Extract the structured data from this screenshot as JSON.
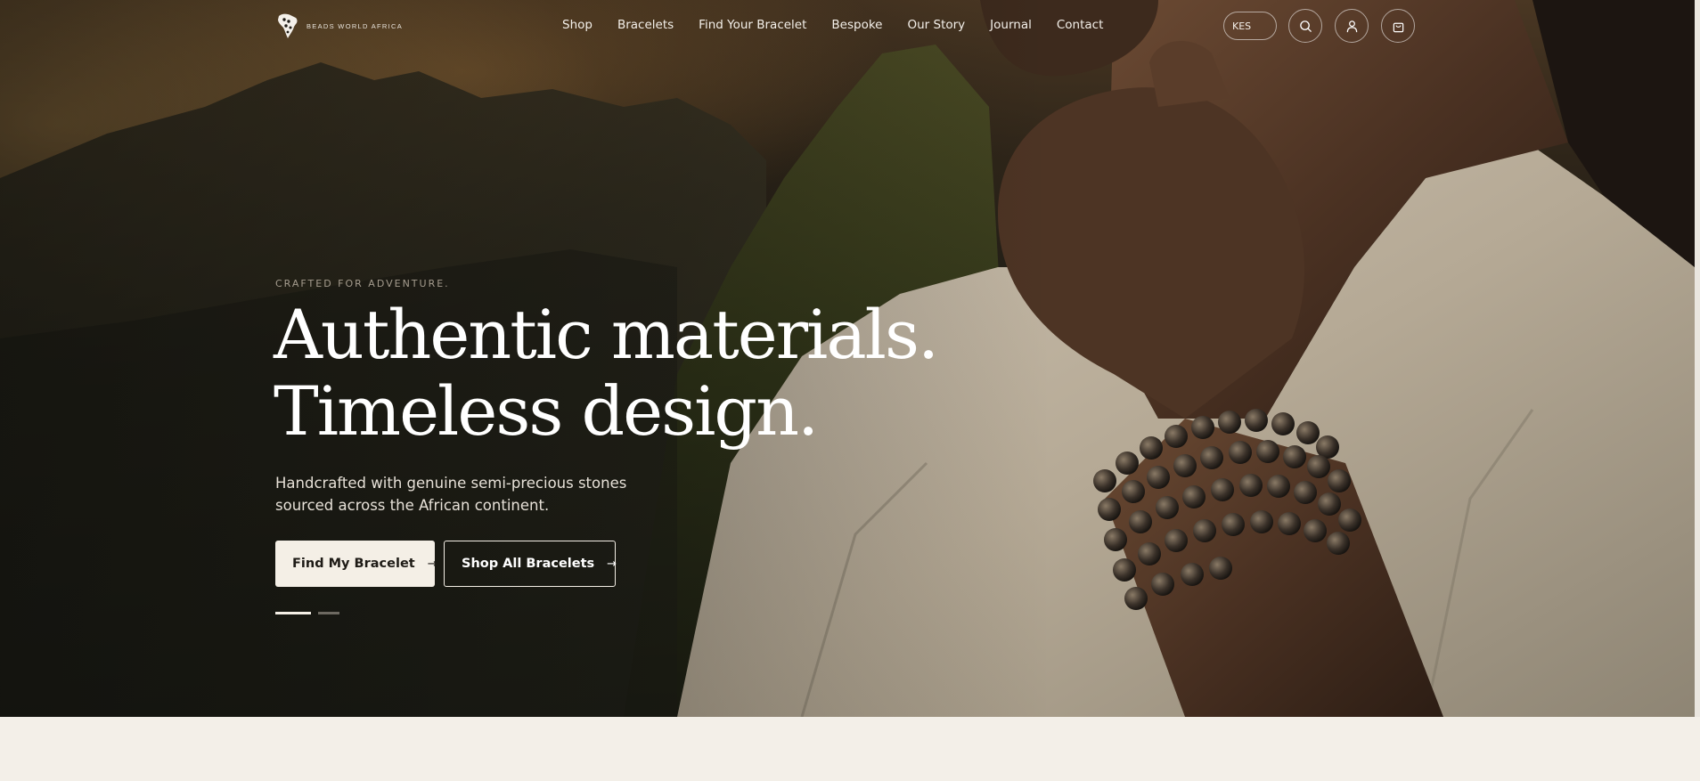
{
  "brand": {
    "name": "BEADS WORLD AFRICA",
    "logo_icon": "africa-bead-logo"
  },
  "nav": {
    "items": [
      "Shop",
      "Bracelets",
      "Find Your Bracelet",
      "Bespoke",
      "Our Story",
      "Journal",
      "Contact"
    ]
  },
  "header": {
    "currency": "KES",
    "icons": [
      "search-icon",
      "user-icon",
      "cart-icon"
    ]
  },
  "hero": {
    "eyebrow": "CRAFTED FOR ADVENTURE.",
    "headline_line1": "Authentic materials.",
    "headline_line2": "Timeless design.",
    "subtext": "Handcrafted with genuine semi-precious stones sourced across the African continent.",
    "primary_cta": "Find My Bracelet",
    "secondary_cta": "Shop All Bracelets",
    "arrow": "→",
    "slides": {
      "current": 1,
      "total": 2
    }
  },
  "colors": {
    "accent_cream": "#f4efe6",
    "text_light": "#ffffff",
    "section_bg": "#f3efe8"
  }
}
